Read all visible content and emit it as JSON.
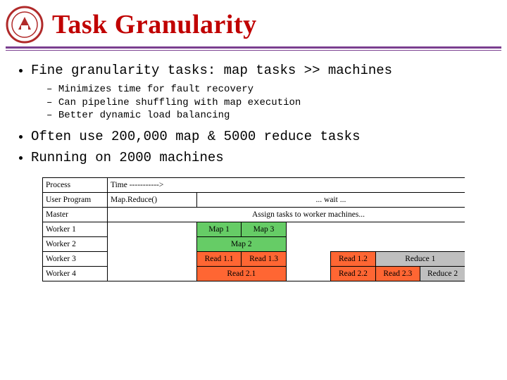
{
  "header": {
    "title": "Task Granularity"
  },
  "bullets": {
    "b1": "Fine granularity tasks:   map tasks >> machines",
    "b1_subs": {
      "s1": "Minimizes time for fault recovery",
      "s2": "Can pipeline shuffling with map execution",
      "s3": "Better dynamic load balancing"
    },
    "b2": "Often use 200,000 map  &  5000 reduce tasks",
    "b3": "Running on 2000 machines"
  },
  "table": {
    "rows": {
      "r0": {
        "label": "Process",
        "time": "Time ----------->"
      },
      "r1": {
        "label": "User Program",
        "c0": "Map.Reduce()",
        "c1": "... wait ..."
      },
      "r2": {
        "label": "Master",
        "c0": "Assign tasks to worker machines..."
      },
      "r3": {
        "label": "Worker 1",
        "m1": "Map 1",
        "m3": "Map 3"
      },
      "r4": {
        "label": "Worker 2",
        "m2": "Map 2"
      },
      "r5": {
        "label": "Worker 3",
        "rd11": "Read 1.1",
        "rd13": "Read 1.3",
        "rd12": "Read 1.2",
        "red1": "Reduce 1"
      },
      "r6": {
        "label": "Worker 4",
        "rd21": "Read 2.1",
        "rd22": "Read 2.2",
        "rd23": "Read 2.3",
        "red2": "Reduce 2"
      }
    }
  }
}
